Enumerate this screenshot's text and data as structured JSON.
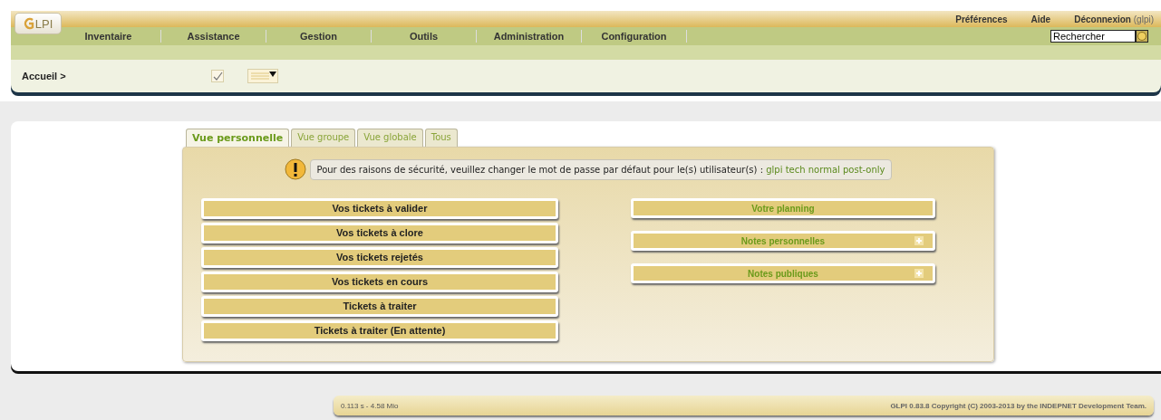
{
  "header": {
    "logo": "LPI",
    "top_links": [
      {
        "label": "Préférences"
      },
      {
        "label": "Aide"
      },
      {
        "label": "Déconnexion",
        "suffix": "(glpi)"
      }
    ],
    "menu": [
      "Inventaire",
      "Assistance",
      "Gestion",
      "Outils",
      "Administration",
      "Configuration"
    ],
    "search": {
      "value": "Rechercher"
    },
    "breadcrumb": "Accueil >"
  },
  "tabs": [
    {
      "label": "Vue personnelle",
      "selected": true
    },
    {
      "label": "Vue groupe",
      "selected": false
    },
    {
      "label": "Vue globale",
      "selected": false
    },
    {
      "label": "Tous",
      "selected": false
    }
  ],
  "notice": {
    "message": "Pour des raisons de sécurité, veuillez changer le mot de passe par défaut pour le(s) utilisateur(s) :",
    "users": "glpi tech normal post-only"
  },
  "left_panels": [
    "Vos tickets à valider",
    "Vos tickets à clore",
    "Vos tickets rejetés",
    "Vos tickets en cours",
    "Tickets à traiter",
    "Tickets à traiter (En attente)"
  ],
  "right_panels": [
    {
      "label": "Votre planning",
      "expandable": false
    },
    {
      "label": "Notes personnelles",
      "expandable": true
    },
    {
      "label": "Notes publiques",
      "expandable": true
    }
  ],
  "footer": {
    "timing": "0.113 s - 4.58 Mio",
    "copyright": "GLPI 0.83.8 Copyright (C) 2003-2013 by the INDEPNET Development Team."
  }
}
